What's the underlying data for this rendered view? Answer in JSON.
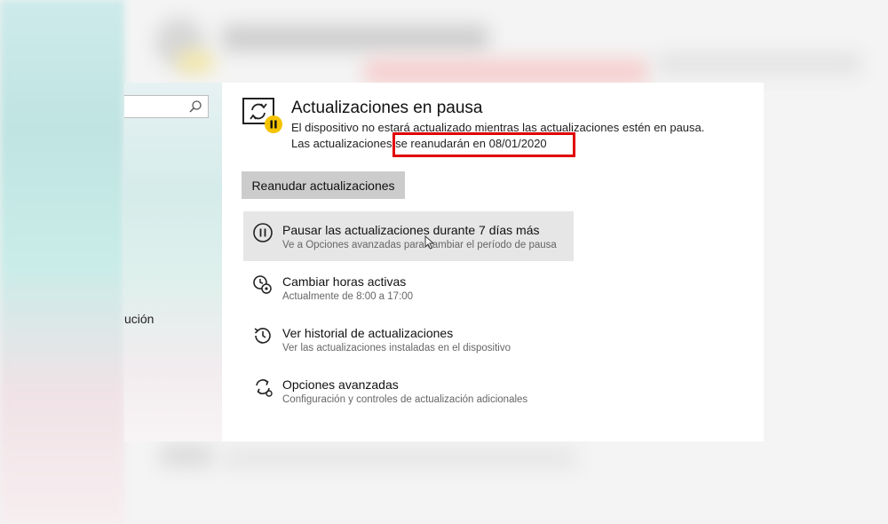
{
  "sidebar": {
    "search_placeholder": "",
    "nav_label": "ución"
  },
  "status": {
    "icon": "update-paused-icon",
    "title": "Actualizaciones en pausa",
    "line1": "El dispositivo no estará actualizado mientras las actualizaciones estén en pausa.",
    "line2_prefix": "Las actualizaciones ",
    "line2_highlight": "se reanudarán en 08/01/2020",
    "highlight_color": "#e00000"
  },
  "resume_button": "Reanudar actualizaciones",
  "options": [
    {
      "icon": "pause-icon",
      "title": "Pausar las actualizaciones durante 7 días más",
      "subtitle": "Ve a Opciones avanzadas para cambiar el período de pausa"
    },
    {
      "icon": "active-hours-icon",
      "title": "Cambiar horas activas",
      "subtitle": "Actualmente de 8:00 a 17:00"
    },
    {
      "icon": "history-icon",
      "title": "Ver historial de actualizaciones",
      "subtitle": "Ver las actualizaciones instaladas en el dispositivo"
    },
    {
      "icon": "advanced-options-icon",
      "title": "Opciones avanzadas",
      "subtitle": "Configuración y controles de actualización adicionales"
    }
  ]
}
